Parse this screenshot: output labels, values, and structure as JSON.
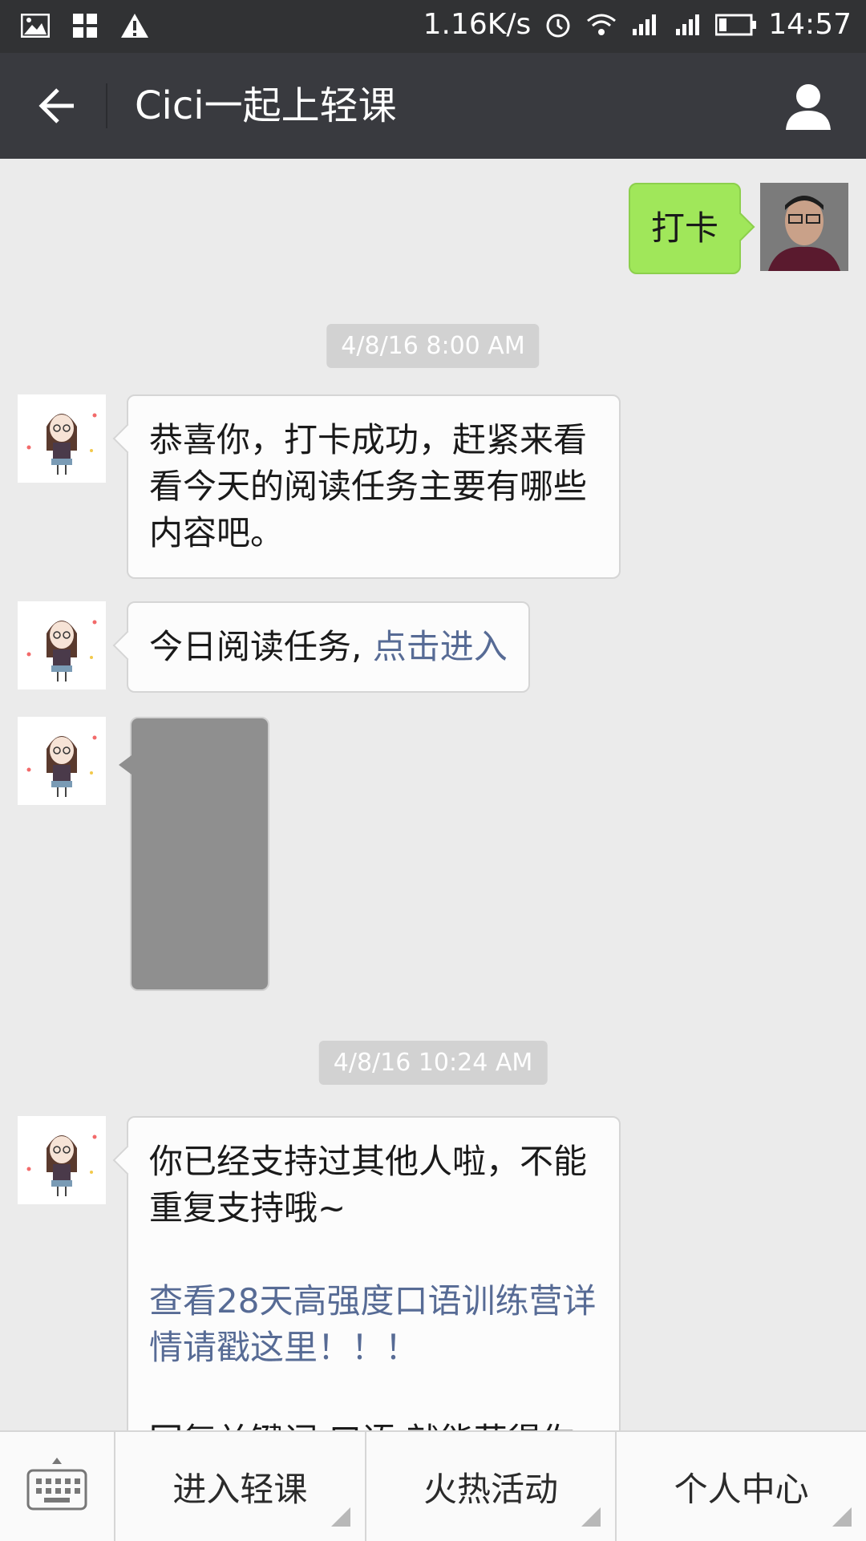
{
  "status": {
    "speed": "1.16K/s",
    "time": "14:57"
  },
  "header": {
    "title": "Cici一起上轻课"
  },
  "messages": {
    "outgoing": {
      "text": "打卡"
    },
    "ts1": "4/8/16 8:00 AM",
    "m1": "恭喜你，打卡成功，赶紧来看看今天的阅读任务主要有哪些内容吧。",
    "m2_prefix": "今日阅读任务, ",
    "m2_link": "点击进入",
    "ts2": "4/8/16 10:24 AM",
    "m4_text": "你已经支持过其他人啦，不能重复支持哦~",
    "m4_link": "查看28天高强度口语训练营详情请戳这里！！！",
    "m4_tail": "回复关键词 口语 就能获得你的"
  },
  "bottom": {
    "menu1": "进入轻课",
    "menu2": "火热活动",
    "menu3": "个人中心"
  }
}
